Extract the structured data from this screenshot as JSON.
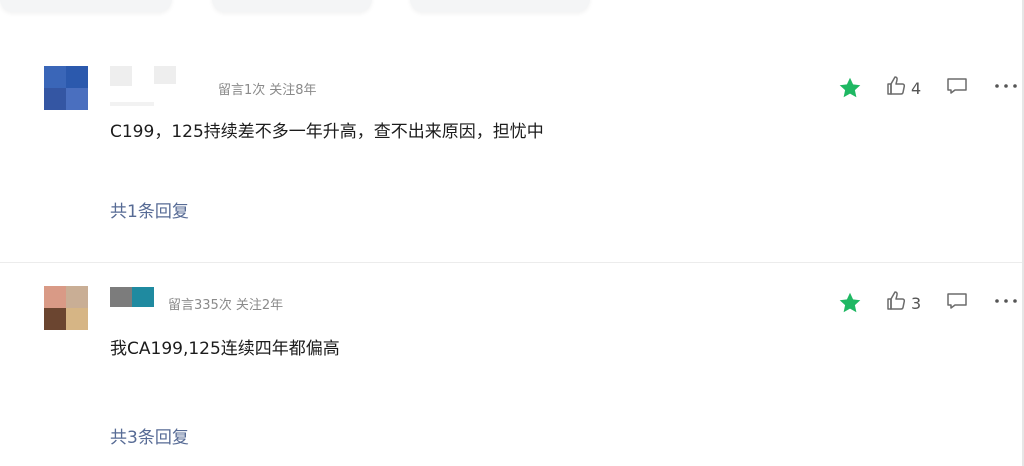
{
  "comments": [
    {
      "meta_posts": "留言1次",
      "meta_follow": "关注8年",
      "content": "C199，125持续差不多一年升高，查不出来原因，担忧中",
      "likes": "4",
      "replies": "共1条回复",
      "starred": true
    },
    {
      "meta_posts": "留言335次",
      "meta_follow": "关注2年",
      "content": "我CA199,125连续四年都偏高",
      "likes": "3",
      "replies": "共3条回复",
      "starred": true
    }
  ],
  "icons": {
    "star": "star-icon",
    "like": "thumbs-up-icon",
    "reply": "comment-icon",
    "more": "more-dots-icon"
  },
  "colors": {
    "star": "#1fb863",
    "link": "#576b95",
    "meta": "#8a8a8a"
  }
}
